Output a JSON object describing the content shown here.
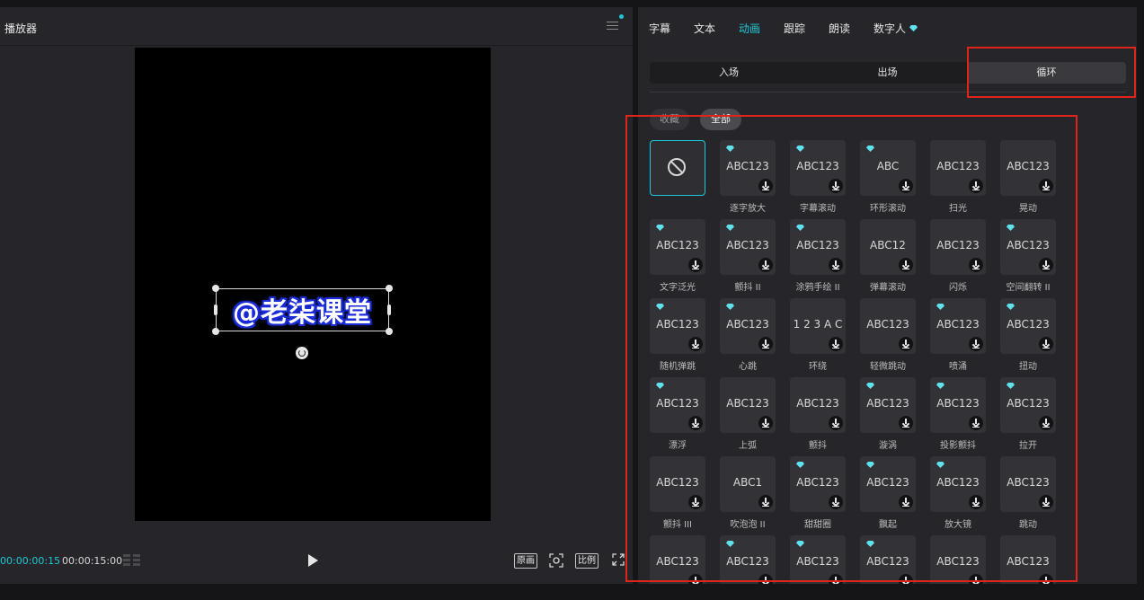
{
  "player": {
    "title": "播放器",
    "overlay_text": "@老柒课堂",
    "time_current": "00:00:00:15",
    "time_total": "00:00:15:00",
    "btn_original": "原画",
    "btn_ratio": "比例"
  },
  "inspector": {
    "tabs": [
      "字幕",
      "文本",
      "动画",
      "跟踪",
      "朗读",
      "数字人"
    ],
    "active_tab": "动画",
    "segments": [
      "入场",
      "出场",
      "循环"
    ],
    "active_segment": "循环",
    "filters": [
      "收藏",
      "全部"
    ],
    "active_filter": "全部",
    "items": [
      {
        "label": "",
        "thumb": "",
        "premium": false,
        "none": true
      },
      {
        "label": "逐字放大",
        "thumb": "ABC123",
        "premium": true
      },
      {
        "label": "字幕滚动",
        "thumb": "ABC123",
        "premium": true
      },
      {
        "label": "环形滚动",
        "thumb": "ABC",
        "premium": true
      },
      {
        "label": "扫光",
        "thumb": "ABC123",
        "premium": false
      },
      {
        "label": "晃动",
        "thumb": "ABC123",
        "premium": false
      },
      {
        "label": "文字泛光",
        "thumb": "ABC123",
        "premium": true
      },
      {
        "label": "颤抖 II",
        "thumb": "ABC123",
        "premium": true
      },
      {
        "label": "涂鸦手绘 II",
        "thumb": "ABC123",
        "premium": true
      },
      {
        "label": "弹幕滚动",
        "thumb": "ABC12",
        "premium": false
      },
      {
        "label": "闪烁",
        "thumb": "ABC123",
        "premium": false
      },
      {
        "label": "空间翻转 II",
        "thumb": "ABC123",
        "premium": true
      },
      {
        "label": "随机弹跳",
        "thumb": "ABC123",
        "premium": true
      },
      {
        "label": "心跳",
        "thumb": "ABC123",
        "premium": true
      },
      {
        "label": "环绕",
        "thumb": "1 2 3 A C",
        "premium": false
      },
      {
        "label": "轻微跳动",
        "thumb": "ABC123",
        "premium": false
      },
      {
        "label": "喷涌",
        "thumb": "ABC123",
        "premium": true
      },
      {
        "label": "扭动",
        "thumb": "ABC123",
        "premium": true
      },
      {
        "label": "漂浮",
        "thumb": "ABC123",
        "premium": true
      },
      {
        "label": "上弧",
        "thumb": "ABC123",
        "premium": false
      },
      {
        "label": "颤抖",
        "thumb": "ABC123",
        "premium": false
      },
      {
        "label": "漩涡",
        "thumb": "ABC123",
        "premium": true
      },
      {
        "label": "投影颤抖",
        "thumb": "ABC123",
        "premium": true
      },
      {
        "label": "拉开",
        "thumb": "ABC123",
        "premium": true
      },
      {
        "label": "颤抖 III",
        "thumb": "ABC123",
        "premium": false
      },
      {
        "label": "吹泡泡 II",
        "thumb": "ABC1",
        "premium": false
      },
      {
        "label": "甜甜圈",
        "thumb": "ABC123",
        "premium": true
      },
      {
        "label": "飘起",
        "thumb": "ABC123",
        "premium": true
      },
      {
        "label": "放大镜",
        "thumb": "ABC123",
        "premium": true
      },
      {
        "label": "跳动",
        "thumb": "ABC123",
        "premium": false
      },
      {
        "label": "",
        "thumb": "ABC123",
        "premium": false
      },
      {
        "label": "",
        "thumb": "ABC123",
        "premium": true
      },
      {
        "label": "",
        "thumb": "ABC123",
        "premium": true
      },
      {
        "label": "",
        "thumb": "ABC123",
        "premium": true
      },
      {
        "label": "",
        "thumb": "ABC123",
        "premium": false
      },
      {
        "label": "",
        "thumb": "ABC123",
        "premium": false
      }
    ]
  },
  "colors": {
    "accent": "#1fc8d6",
    "annotation": "#e0231b",
    "panel": "#26262a"
  }
}
